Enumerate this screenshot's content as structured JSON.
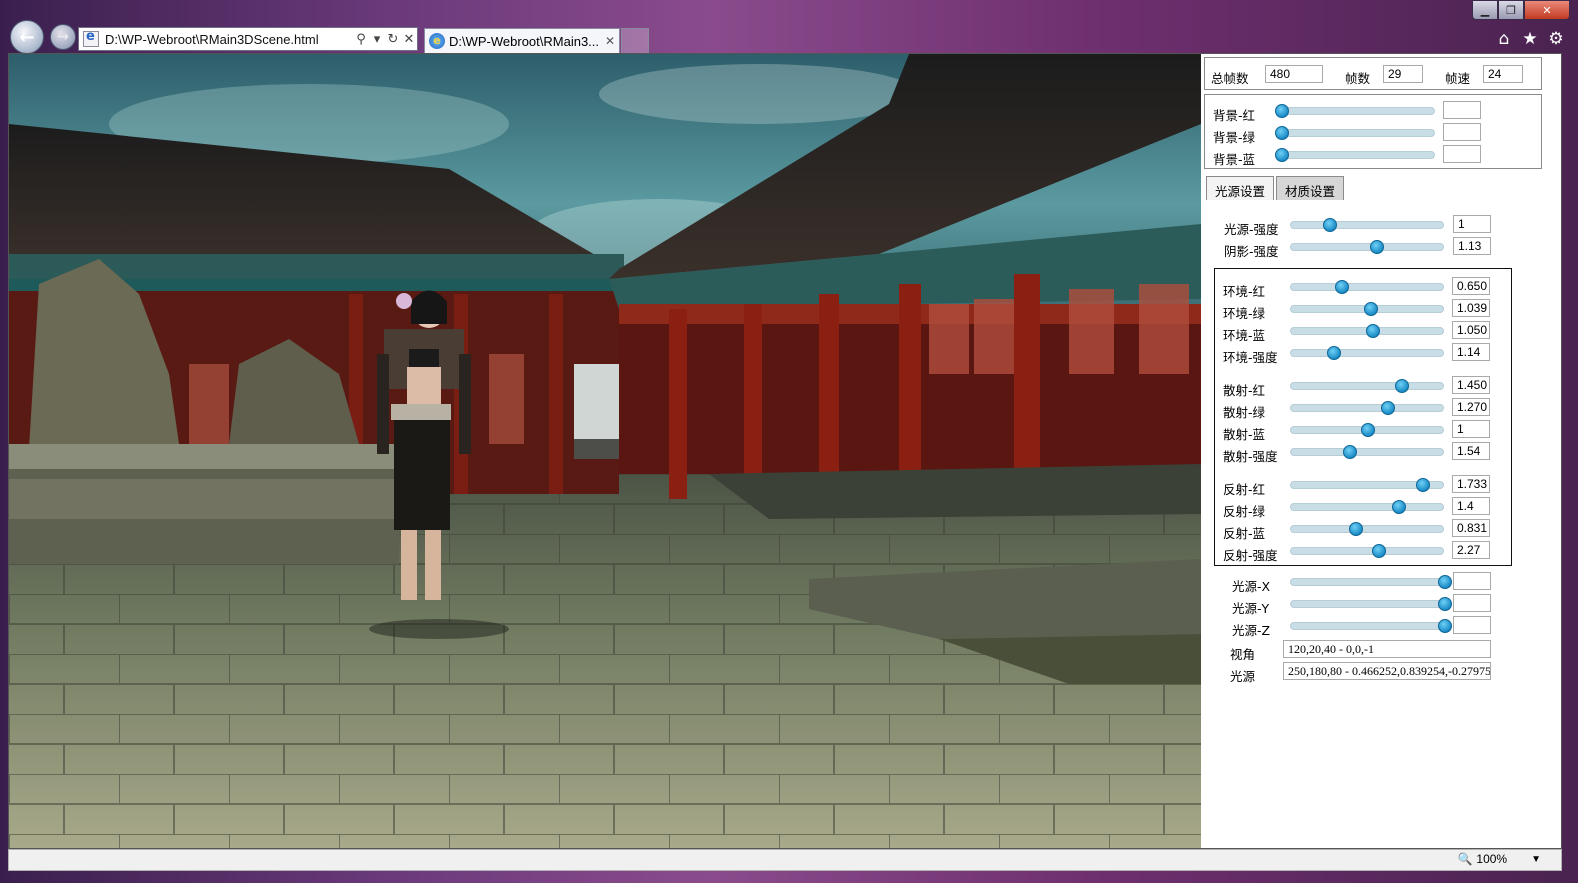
{
  "browser": {
    "address_url": "D:\\WP-Webroot\\RMain3DScene.html",
    "tab_label": "D:\\WP-Webroot\\RMain3...",
    "win_min": "▁",
    "win_max": "❐",
    "win_close": "✕",
    "icons": {
      "back": "back-arrow-icon",
      "forward": "forward-arrow-icon",
      "search": "search-icon",
      "refresh": "refresh-icon",
      "stop": "close-icon",
      "home": "home-icon",
      "favorites": "star-icon",
      "tools": "gear-icon"
    },
    "zoom": "100%"
  },
  "frames": {
    "total_label": "总帧数",
    "total_value": "480",
    "frame_label": "帧数",
    "frame_value": "29",
    "rate_label": "帧速",
    "rate_value": "24"
  },
  "background": {
    "items": [
      {
        "label": "背景-红",
        "value": "",
        "level": 0.0
      },
      {
        "label": "背景-绿",
        "value": "",
        "level": 0.0
      },
      {
        "label": "背景-蓝",
        "value": "",
        "level": 0.0
      }
    ]
  },
  "tabs": [
    {
      "label": "光源设置",
      "active": true
    },
    {
      "label": "材质设置",
      "active": false
    }
  ],
  "light": {
    "top": [
      {
        "label": "光源-强度",
        "value": "1",
        "level": 0.25
      },
      {
        "label": "阴影-强度",
        "value": "1.13",
        "level": 0.56
      }
    ],
    "ambient": [
      {
        "label": "环境-红",
        "value": "0.650",
        "level": 0.33
      },
      {
        "label": "环境-绿",
        "value": "1.039",
        "level": 0.52
      },
      {
        "label": "环境-蓝",
        "value": "1.050",
        "level": 0.53
      },
      {
        "label": "环境-强度",
        "value": "1.14",
        "level": 0.28
      }
    ],
    "diffuse": [
      {
        "label": "散射-红",
        "value": "1.450",
        "level": 0.72
      },
      {
        "label": "散射-绿",
        "value": "1.270",
        "level": 0.63
      },
      {
        "label": "散射-蓝",
        "value": "1",
        "level": 0.5
      },
      {
        "label": "散射-强度",
        "value": "1.54",
        "level": 0.38
      }
    ],
    "specular": [
      {
        "label": "反射-红",
        "value": "1.733",
        "level": 0.86
      },
      {
        "label": "反射-绿",
        "value": "1.4",
        "level": 0.7
      },
      {
        "label": "反射-蓝",
        "value": "0.831",
        "level": 0.42
      },
      {
        "label": "反射-强度",
        "value": "2.27",
        "level": 0.57
      }
    ],
    "position": [
      {
        "label": "光源-X",
        "value": "",
        "level": 1.0
      },
      {
        "label": "光源-Y",
        "value": "",
        "level": 1.0
      },
      {
        "label": "光源-Z",
        "value": "",
        "level": 1.0
      }
    ],
    "view_label": "视角",
    "view_value": "120,20,40 - 0,0,-1",
    "source_label": "光源",
    "source_value": "250,180,80 - 0.466252,0.839254,-0.27975"
  }
}
